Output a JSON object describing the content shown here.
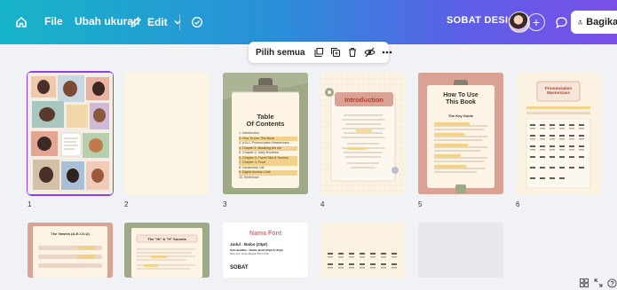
{
  "topbar": {
    "file_label": "File",
    "resize_label": "Ubah ukuran",
    "edit_label": "Edit",
    "brand_name": "SOBAT DESIGN",
    "share_label": "Bagikan"
  },
  "selection_bar": {
    "select_all_label": "Pilih semua"
  },
  "pages": [
    {
      "number": "1"
    },
    {
      "number": "2"
    },
    {
      "number": "3",
      "title": "Table\nOf Contents"
    },
    {
      "number": "4",
      "title": "Introduction"
    },
    {
      "number": "5",
      "title": "How To Use\nThis Book",
      "subtitle": "The Key Guide"
    },
    {
      "number": "6",
      "title": "Pronunciation\nMasterclass"
    }
  ],
  "page3_toc": [
    "1. Introduction",
    "2. How To Use This Book",
    "3. A-B-C Pronunciation Masterclass",
    "4. Chapter 1: Breaking the Ice",
    "5. Chapter 2: Daily Routines",
    "6. Chapter 3: Travel Talk & Tourism",
    "7. Chapter 4: Food",
    "8. Vocabulary List",
    "9. Digital Access Code",
    "10. Reference"
  ],
  "row2": {
    "p7_title": "The Vowels (A-E-I-O-U)",
    "p8_title": "The \"Hi\" & \"H\" Sounds",
    "p9_title": "Nama Font",
    "p9_judul": "Judul : Baloo (23pt)",
    "p9_sub": "Sub Headline : Nunito Bold (15pt) & (12pt)",
    "p9_body": "Body Text: Nunito Regular 8/8 pt & 8pt",
    "p9_brand": "SOBAT"
  },
  "colors": {
    "accent": "#8b3dff",
    "topbar_start": "#17b4c9",
    "topbar_end": "#7a4fe8",
    "cream": "#fdf5e4",
    "salmon": "#d9a294",
    "olive": "#9ea987",
    "title_red": "#b53a2c"
  },
  "icons": {
    "home": "home-icon",
    "edit": "pencil-icon",
    "cloud": "cloud-sync-icon",
    "comment": "comment-icon",
    "share": "share-icon"
  }
}
